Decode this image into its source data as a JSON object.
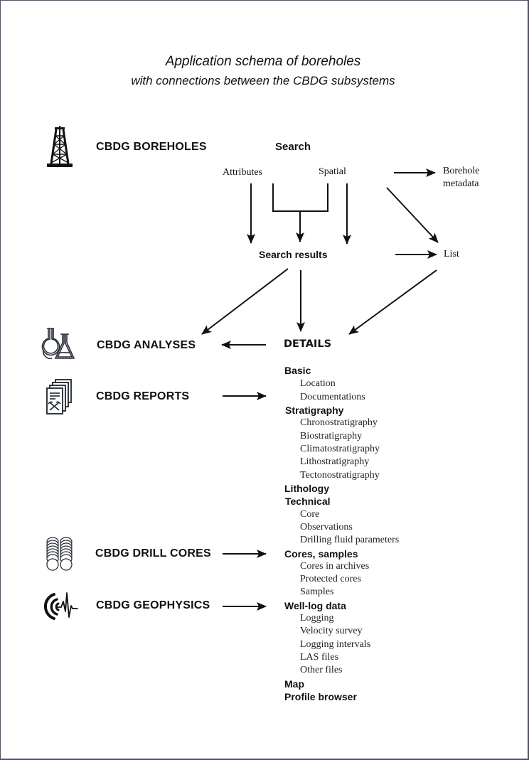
{
  "title": {
    "line1": "Application schema of boreholes",
    "line2": "with connections between the CBDG subsystems"
  },
  "subsystems": [
    {
      "label": "CBDG BOREHOLES",
      "icon": "drilling-rig-icon"
    },
    {
      "label": "CBDG ANALYSES",
      "icon": "lab-flasks-icon"
    },
    {
      "label": "CBDG REPORTS",
      "icon": "report-documents-icon"
    },
    {
      "label": "CBDG DRILL CORES",
      "icon": "drill-cores-icon"
    },
    {
      "label": "CBDG GEOPHYSICS",
      "icon": "seismic-wave-icon"
    }
  ],
  "flow": {
    "search": "Search",
    "attributes": "Attributes",
    "spatial": "Spatial",
    "borehole_metadata_line1": "Borehole",
    "borehole_metadata_line2": "metadata",
    "search_results": "Search results",
    "list": "List",
    "details": "DETAILS"
  },
  "details": [
    {
      "category": "Basic",
      "items": [
        "Location",
        "Documentations"
      ]
    },
    {
      "category": "Stratigraphy",
      "items": [
        "Chronostratigraphy",
        "Biostratigraphy",
        "Climatostratigraphy",
        "Lithostratigraphy",
        "Tectonostratigraphy"
      ]
    },
    {
      "category": "Lithology",
      "items": []
    },
    {
      "category": "Technical",
      "items": [
        "Core",
        "Observations",
        "Drilling fluid parameters"
      ]
    },
    {
      "category": "Cores, samples",
      "items": [
        "Cores in archives",
        "Protected cores",
        "Samples"
      ]
    },
    {
      "category": "Well-log data",
      "items": [
        "Logging",
        "Velocity survey",
        "Logging intervals",
        "LAS files",
        "Other files"
      ]
    },
    {
      "category": "Map",
      "items": []
    },
    {
      "category": "Profile browser",
      "items": []
    }
  ],
  "colors": {
    "frame": "#4a5470",
    "ink": "#111111"
  }
}
